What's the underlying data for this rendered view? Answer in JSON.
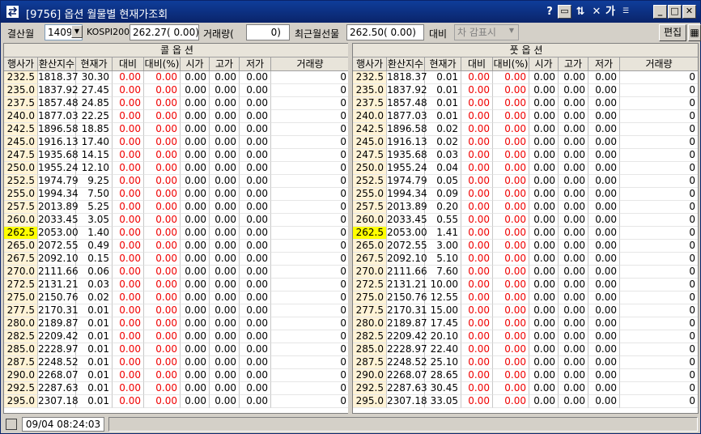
{
  "window": {
    "title": "[9756] 옵션 월물별 현재가조회",
    "help_label": "?",
    "font_label": "가"
  },
  "toolbar": {
    "month_label": "결산월",
    "month_value": "1409",
    "kospi_label": "KOSPI200",
    "kospi_value": "262.27( 0.00)",
    "volume_label": "거래량(",
    "volume_value": "0)",
    "near_futures_label": "최근월선물",
    "near_futures_value": "262.50( 0.00)",
    "change_label": "대비",
    "display_select": "차  감표시",
    "edit_button": "편집"
  },
  "call": {
    "title": "콜 옵 션",
    "headers": [
      "행사가",
      "환산지수",
      "현재가",
      "대비",
      "대비(%)",
      "시가",
      "고가",
      "저가",
      "거래량"
    ]
  },
  "put": {
    "title": "풋 옵 션",
    "headers": [
      "행사가",
      "환산지수",
      "현재가",
      "대비",
      "대비(%)",
      "시가",
      "고가",
      "저가",
      "거래량"
    ]
  },
  "atm_strike": "262.5",
  "rows": [
    {
      "strike": "232.5",
      "index": "1818.37",
      "call": "30.30",
      "put": "0.01"
    },
    {
      "strike": "235.0",
      "index": "1837.92",
      "call": "27.45",
      "put": "0.01"
    },
    {
      "strike": "237.5",
      "index": "1857.48",
      "call": "24.85",
      "put": "0.01"
    },
    {
      "strike": "240.0",
      "index": "1877.03",
      "call": "22.25",
      "put": "0.01"
    },
    {
      "strike": "242.5",
      "index": "1896.58",
      "call": "18.85",
      "put": "0.02"
    },
    {
      "strike": "245.0",
      "index": "1916.13",
      "call": "17.40",
      "put": "0.02"
    },
    {
      "strike": "247.5",
      "index": "1935.68",
      "call": "14.15",
      "put": "0.03"
    },
    {
      "strike": "250.0",
      "index": "1955.24",
      "call": "12.10",
      "put": "0.04"
    },
    {
      "strike": "252.5",
      "index": "1974.79",
      "call": "9.25",
      "put": "0.05"
    },
    {
      "strike": "255.0",
      "index": "1994.34",
      "call": "7.50",
      "put": "0.09"
    },
    {
      "strike": "257.5",
      "index": "2013.89",
      "call": "5.25",
      "put": "0.20"
    },
    {
      "strike": "260.0",
      "index": "2033.45",
      "call": "3.05",
      "put": "0.55"
    },
    {
      "strike": "262.5",
      "index": "2053.00",
      "call": "1.40",
      "put": "1.41"
    },
    {
      "strike": "265.0",
      "index": "2072.55",
      "call": "0.49",
      "put": "3.00"
    },
    {
      "strike": "267.5",
      "index": "2092.10",
      "call": "0.15",
      "put": "5.10"
    },
    {
      "strike": "270.0",
      "index": "2111.66",
      "call": "0.06",
      "put": "7.60"
    },
    {
      "strike": "272.5",
      "index": "2131.21",
      "call": "0.03",
      "put": "10.00"
    },
    {
      "strike": "275.0",
      "index": "2150.76",
      "call": "0.02",
      "put": "12.55"
    },
    {
      "strike": "277.5",
      "index": "2170.31",
      "call": "0.01",
      "put": "15.00"
    },
    {
      "strike": "280.0",
      "index": "2189.87",
      "call": "0.01",
      "put": "17.45"
    },
    {
      "strike": "282.5",
      "index": "2209.42",
      "call": "0.01",
      "put": "20.10"
    },
    {
      "strike": "285.0",
      "index": "2228.97",
      "call": "0.01",
      "put": "22.40"
    },
    {
      "strike": "287.5",
      "index": "2248.52",
      "call": "0.01",
      "put": "25.10"
    },
    {
      "strike": "290.0",
      "index": "2268.07",
      "call": "0.01",
      "put": "28.65"
    },
    {
      "strike": "292.5",
      "index": "2287.63",
      "call": "0.01",
      "put": "30.45"
    },
    {
      "strike": "295.0",
      "index": "2307.18",
      "call": "0.01",
      "put": "33.05"
    }
  ],
  "zero_price": "0.00",
  "zero_volume": "0",
  "colors": {
    "title_bg": "#0a246a",
    "change_red": "#f00000",
    "atm_highlight": "#ffff00",
    "strike_bg": "#fff3d6"
  },
  "status": {
    "time": "09/04 08:24:03"
  }
}
